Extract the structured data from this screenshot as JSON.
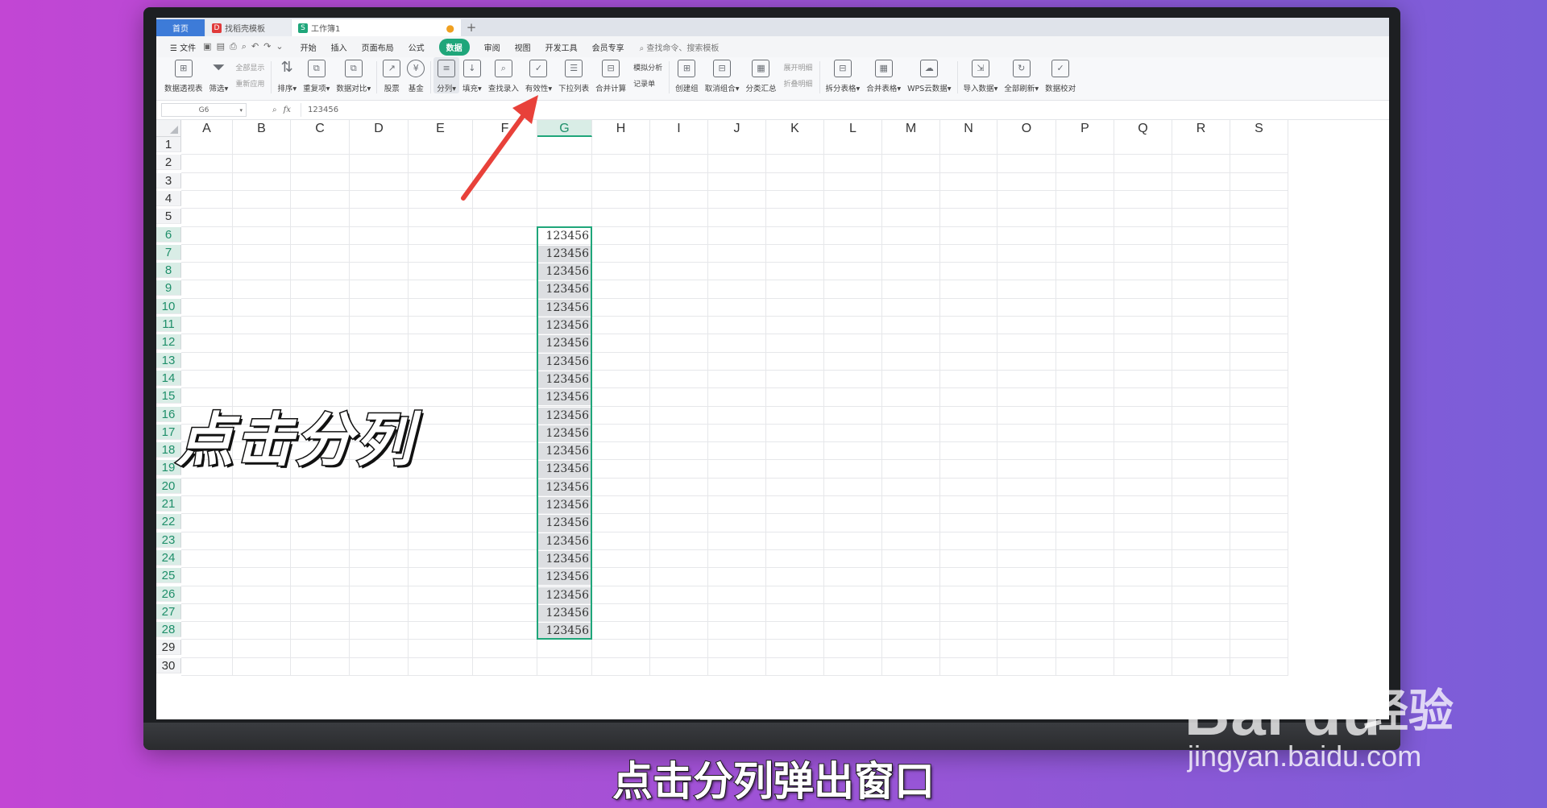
{
  "tabs": {
    "home": "首页",
    "template": "找稻壳模板",
    "workbook": "工作簿1",
    "add": "+"
  },
  "menu": {
    "file": "文件",
    "items": [
      "开始",
      "插入",
      "页面布局",
      "公式",
      "数据",
      "审阅",
      "视图",
      "开发工具",
      "会员专享"
    ],
    "search": "查找命令、搜索模板"
  },
  "ribbon": {
    "pivot": "数据透视表",
    "filter": "筛选",
    "show_all": "全部显示",
    "reapply": "重新应用",
    "sort": "排序",
    "dup": "重复项",
    "compare": "数据对比",
    "stock": "股票",
    "fund": "基金",
    "split": "分列",
    "fill": "填充",
    "lookup": "查找录入",
    "validity": "有效性",
    "dropdown": "下拉列表",
    "consolidate": "合并计算",
    "simulate": "模拟分析",
    "record": "记录单",
    "group": "创建组",
    "ungroup": "取消组合",
    "subtotal": "分类汇总",
    "expand": "展开明细",
    "collapse": "折叠明细",
    "split_table": "拆分表格",
    "merge_table": "合并表格",
    "cloud": "WPS云数据",
    "import": "导入数据",
    "refresh_all": "全部刷新",
    "verify": "数据校对"
  },
  "formula_bar": {
    "name_box": "G6",
    "fx": "fx",
    "value": "123456"
  },
  "columns": [
    "A",
    "B",
    "C",
    "D",
    "E",
    "F",
    "G",
    "H",
    "I",
    "J",
    "K",
    "L",
    "M",
    "N",
    "O",
    "P",
    "Q",
    "R",
    "S"
  ],
  "rows": [
    "1",
    "2",
    "3",
    "4",
    "5",
    "6",
    "7",
    "8",
    "9",
    "10",
    "11",
    "12",
    "13",
    "14",
    "15",
    "16",
    "17",
    "18",
    "19",
    "20",
    "21",
    "22",
    "23",
    "24",
    "25",
    "26",
    "27",
    "28",
    "29",
    "30"
  ],
  "selected_column": "G",
  "selected_rows": "6-28",
  "cell_value": "123456",
  "overlay": {
    "caption": "点击分列",
    "subtitle": "点击分列弹出窗口"
  },
  "watermark": {
    "logo": "Bai du",
    "cn": "经验",
    "url": "jingyan.baidu.com"
  },
  "colors": {
    "accent": "#1fa67a",
    "arrow": "#e8413a",
    "tab_home": "#3d7bd8"
  }
}
